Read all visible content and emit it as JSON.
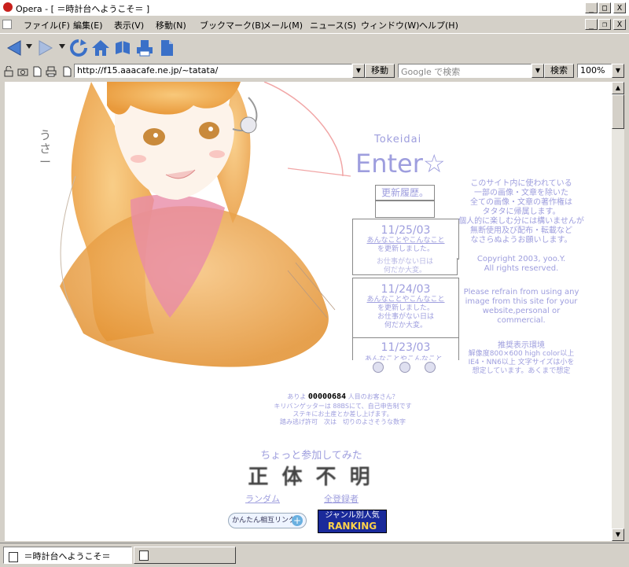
{
  "window": {
    "title": "Opera - [ ＝時計台へようこそ＝ ]",
    "minimize": "_",
    "maximize": "□",
    "close": "X"
  },
  "menu": [
    "ファイル(F)",
    "編集(E)",
    "表示(V)",
    "移動(N)",
    "ブックマーク(B)",
    "メール(M)",
    "ニュース(S)",
    "ウィンドウ(W)",
    "ヘルプ(H)"
  ],
  "address": {
    "url": "http://f15.aaacafe.ne.jp/~tatata/",
    "go_label": "移動",
    "search_placeholder": "Google で検索",
    "search_label": "検索",
    "zoom": "100%"
  },
  "page": {
    "side_doodle": "うさー",
    "logo_small": "Tokeidai",
    "enter_label": "Enter☆",
    "history_label": "更新履歴。",
    "news": [
      {
        "date": "11/25/03",
        "line1": "あんなことやこんなこと",
        "line2": "を更新しました。",
        "line3": "お仕事がない日は",
        "line4": "何だか大変。"
      },
      {
        "date": "11/24/03",
        "line1": "あんなことやこんなこと",
        "line2": "を更新しました。",
        "line3": "お仕事がない日は",
        "line4": "何だか大変。"
      },
      {
        "date": "11/23/03",
        "line1": "あんなことやこんなこと",
        "line2": "",
        "line3": "",
        "line4": ""
      }
    ],
    "overlap_text1": "お仕事がない日は",
    "overlap_text2": "何だか大変。",
    "notice_ja": [
      "このサイト内に使われている",
      "一部の画像・文章を除いた",
      "全ての画像・文章の著作権は",
      "タタタに帰属します。",
      "個人的に楽しむ分には構いませんが",
      "無断使用及び配布・転載など",
      "なさらぬようお願いします。"
    ],
    "copyright": [
      "Copyright 2003, yoo.Y.",
      "All rights reserved."
    ],
    "notice_en": [
      "Please refrain from using any",
      "image from this site for your",
      "website,personal or",
      "commercial."
    ],
    "env_title": "推奨表示環境",
    "env_lines": [
      "解像度800×600 high color以上",
      "IE4・NN6以上 文字サイズは小を",
      "想定しています。あくまで想定"
    ],
    "counter_prefix": "ありよ",
    "counter_value": "00000684",
    "counter_suffix": "人目のお客さん？",
    "kiri_lines": [
      "キリバンゲッターは 88BSにて、自己申告制です",
      "ステキにお土産とか差し上げます。",
      "踏み逃げ許可　次は　切りのよさそうな数字"
    ],
    "join_label": "ちょっと参加してみた",
    "shotai_label": "正 体 不 明",
    "random_link": "ランダム",
    "all_link": "全登録者",
    "mutual_link_banner": "かんたん相互リンク",
    "genre_banner_top": "ジャンル別人気",
    "genre_banner_bottom": "RANKING"
  },
  "status": {
    "tab_title": "＝時計台へようこそ＝"
  }
}
